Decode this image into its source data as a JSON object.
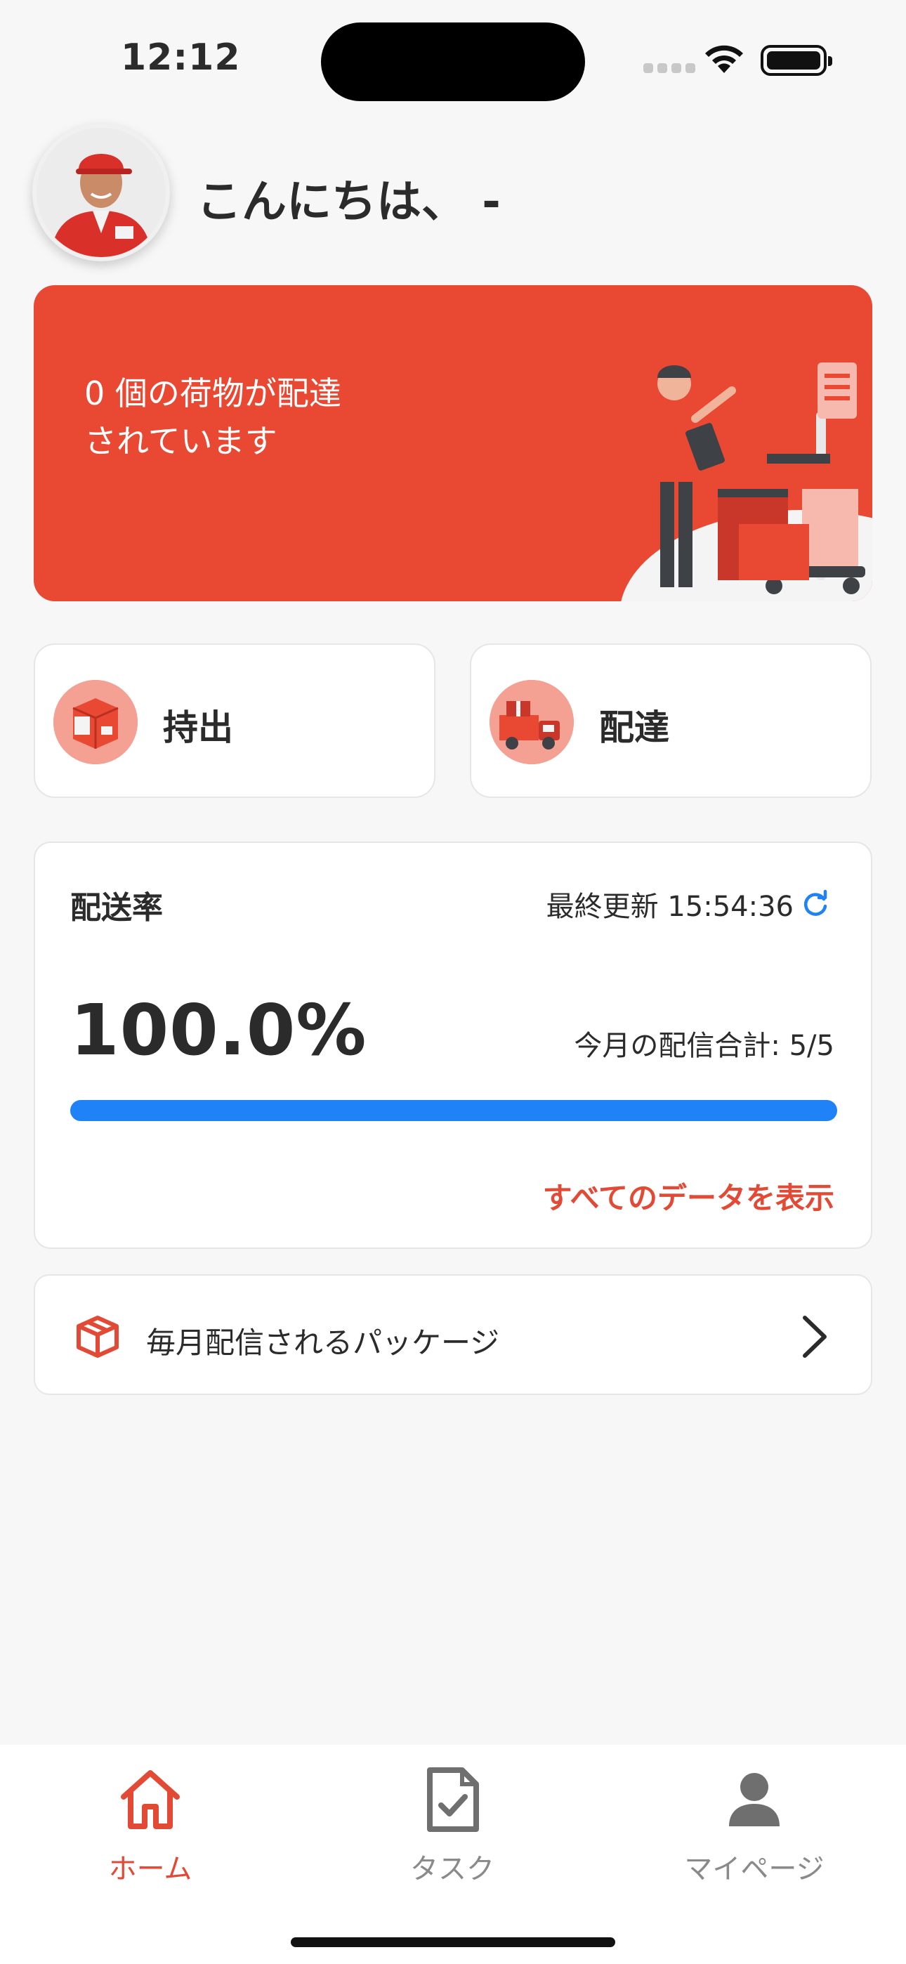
{
  "status_bar": {
    "time": "12:12"
  },
  "header": {
    "greeting": "こんにちは、 -"
  },
  "banner": {
    "line1": "0 個の荷物が配達",
    "line2": "されています"
  },
  "actions": [
    {
      "label": "持出",
      "icon": "package-icon"
    },
    {
      "label": "配達",
      "icon": "delivery-truck-icon"
    }
  ],
  "stats": {
    "title": "配送率",
    "updated_label": "最終更新 15:54:36",
    "percent": "100.0%",
    "progress_fraction": 1.0,
    "monthly_total": "今月の配信合計: 5/5",
    "view_all": "すべてのデータを表示"
  },
  "monthly": {
    "label": "毎月配信されるパッケージ"
  },
  "tabbar": {
    "items": [
      {
        "label": "ホーム",
        "icon": "home-icon",
        "active": true
      },
      {
        "label": "タスク",
        "icon": "task-document-icon",
        "active": false
      },
      {
        "label": "マイページ",
        "icon": "person-icon",
        "active": false
      }
    ]
  },
  "colors": {
    "accent": "#e94833",
    "progress": "#1f82f6",
    "link": "#e24a35"
  }
}
